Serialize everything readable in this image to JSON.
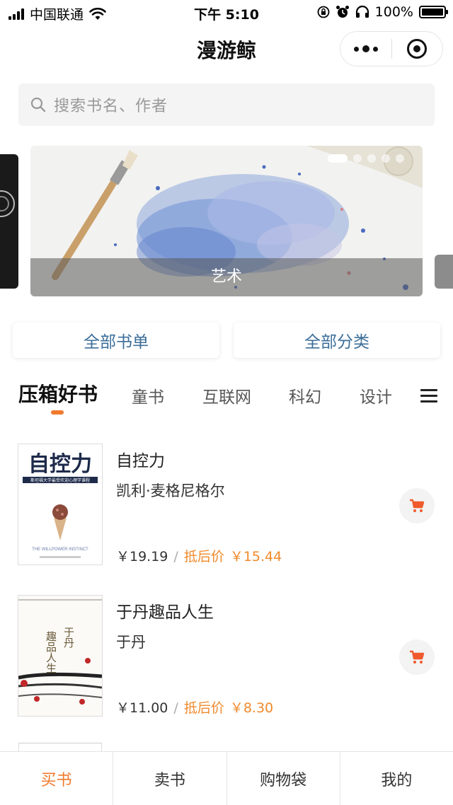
{
  "status_bar": {
    "carrier": "中国联通",
    "time": "下午 5:10",
    "battery": "100%"
  },
  "nav": {
    "title": "漫游鲸"
  },
  "search": {
    "placeholder": "搜索书名、作者"
  },
  "banner": {
    "caption": "艺术",
    "slide_count": 5,
    "active_slide": 1
  },
  "quick_links": {
    "all_lists": "全部书单",
    "all_categories": "全部分类"
  },
  "tabs": [
    {
      "label": "压箱好书",
      "active": true
    },
    {
      "label": "童书"
    },
    {
      "label": "互联网"
    },
    {
      "label": "科幻"
    },
    {
      "label": "设计"
    }
  ],
  "books": [
    {
      "title": "自控力",
      "author": "凯利·麦格尼格尔",
      "price": "￥19.19",
      "discount_label": "抵后价",
      "discount_price": "￥15.44",
      "cover_title": "自控力",
      "cover_subtitle": "斯坦福大学最受欢迎心理学课程",
      "cover_en": "THE WILLPOWER INSTINCT"
    },
    {
      "title": "于丹趣品人生",
      "author": "于丹",
      "price": "￥11.00",
      "discount_label": "抵后价",
      "discount_price": "￥8.30",
      "cover_title_a": "于丹",
      "cover_title_b": "趣品人生"
    }
  ],
  "bottom_tabs": [
    {
      "label": "买书",
      "active": true
    },
    {
      "label": "卖书"
    },
    {
      "label": "购物袋"
    },
    {
      "label": "我的"
    }
  ],
  "colors": {
    "accent": "#f07a2c",
    "link": "#3c6e99"
  }
}
